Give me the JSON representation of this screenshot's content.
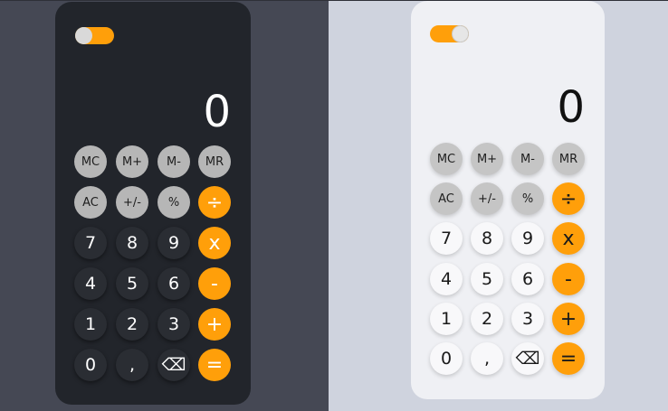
{
  "calculators": [
    {
      "theme": "dark",
      "display": "0",
      "rows": [
        [
          "MC",
          "M+",
          "M-",
          "MR"
        ],
        [
          "AC",
          "+/-",
          "%",
          "÷"
        ],
        [
          "7",
          "8",
          "9",
          "x"
        ],
        [
          "4",
          "5",
          "6",
          "-"
        ],
        [
          "1",
          "2",
          "3",
          "+"
        ],
        [
          "0",
          ",",
          "⌫",
          "="
        ]
      ]
    },
    {
      "theme": "light",
      "display": "0",
      "rows": [
        [
          "MC",
          "M+",
          "M-",
          "MR"
        ],
        [
          "AC",
          "+/-",
          "%",
          "÷"
        ],
        [
          "7",
          "8",
          "9",
          "x"
        ],
        [
          "4",
          "5",
          "6",
          "-"
        ],
        [
          "1",
          "2",
          "3",
          "+"
        ],
        [
          "0",
          ",",
          "⌫",
          "="
        ]
      ]
    }
  ],
  "colors": {
    "accent": "#ff9f0a",
    "dark_background": "#454854",
    "light_background": "#cfd3de",
    "dark_panel": "#22252b",
    "light_panel": "#eff0f4"
  }
}
